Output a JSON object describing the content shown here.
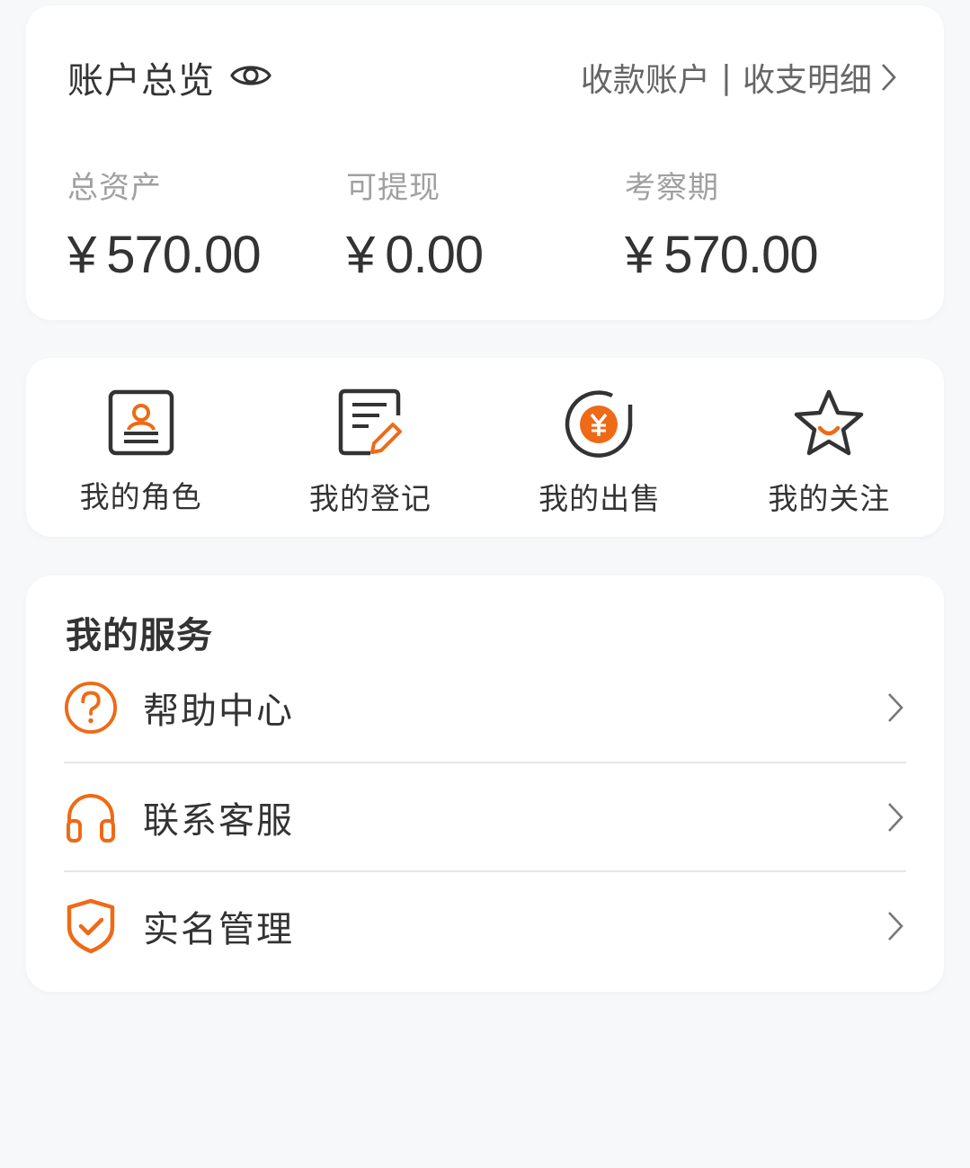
{
  "overview": {
    "title": "账户总览",
    "link_receive_account": "收款账户",
    "link_separator": "|",
    "link_statement": "收支明细",
    "stats": [
      {
        "label": "总资产",
        "currency": "¥",
        "amount": "570.00"
      },
      {
        "label": "可提现",
        "currency": "¥",
        "amount": "0.00"
      },
      {
        "label": "考察期",
        "currency": "¥",
        "amount": "570.00"
      }
    ]
  },
  "actions": [
    {
      "label": "我的角色",
      "icon": "role-card-icon"
    },
    {
      "label": "我的登记",
      "icon": "register-edit-icon"
    },
    {
      "label": "我的出售",
      "icon": "sale-yen-icon"
    },
    {
      "label": "我的关注",
      "icon": "star-icon"
    }
  ],
  "services": {
    "title": "我的服务",
    "items": [
      {
        "label": "帮助中心",
        "icon": "help-circle-icon"
      },
      {
        "label": "联系客服",
        "icon": "headset-icon"
      },
      {
        "label": "实名管理",
        "icon": "shield-check-icon"
      }
    ]
  },
  "colors": {
    "accent": "#ee6a16",
    "dark_icon": "#333333",
    "background": "#f7f8fa",
    "card": "#ffffff"
  }
}
